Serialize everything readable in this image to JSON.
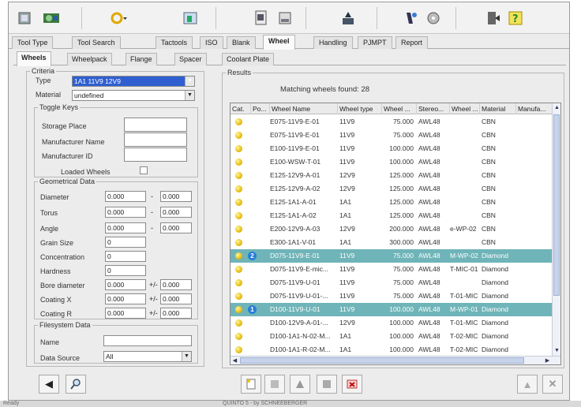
{
  "tabs_main": [
    {
      "label": "Tool Type"
    },
    {
      "label": "Tool Search"
    },
    {
      "label": "Tactools"
    },
    {
      "label": "ISO"
    },
    {
      "label": "Blank"
    },
    {
      "label": "Wheel"
    },
    {
      "label": "Handling"
    },
    {
      "label": "PJMPT"
    },
    {
      "label": "Report"
    }
  ],
  "tabs_sub": [
    {
      "label": "Wheels"
    },
    {
      "label": "Wheelpack"
    },
    {
      "label": "Flange"
    },
    {
      "label": "Spacer"
    },
    {
      "label": "Coolant Plate"
    }
  ],
  "criteria": {
    "legend": "Criteria",
    "type_label": "Type",
    "type_value": "1A1 11V9 12V9",
    "material_label": "Material",
    "material_value": "undefined"
  },
  "toggle_keys": {
    "legend": "Toggle Keys",
    "storage_place": "Storage Place",
    "manufacturer_name": "Manufacturer Name",
    "manufacturer_id": "Manufacturer ID",
    "loaded_wheels": "Loaded Wheels"
  },
  "geometrical": {
    "legend": "Geometrical Data",
    "diameter": "Diameter",
    "diameter_from": "0.000",
    "diameter_to": "0.000",
    "torus": "Torus",
    "torus_from": "0.000",
    "torus_to": "0.000",
    "angle": "Angle",
    "angle_from": "0.000",
    "angle_to": "0.000",
    "grain_size": "Grain Size",
    "grain_size_value": "0",
    "concentration": "Concentration",
    "concentration_value": "0",
    "hardness": "Hardness",
    "hardness_value": "0",
    "bore_diameter": "Bore diameter",
    "bore_diameter_value": "0.000",
    "bore_diameter_tol": "0.000",
    "coating_x": "Coating X",
    "coating_x_value": "0.000",
    "coating_x_tol": "0.000",
    "coating_r": "Coating R",
    "coating_r_value": "0.000",
    "coating_r_tol": "0.000",
    "plus_minus": "+/-",
    "range_dash": "-"
  },
  "filesystem": {
    "legend": "Filesystem Data",
    "name_label": "Name",
    "data_source_label": "Data Source",
    "data_source_value": "All"
  },
  "results": {
    "legend": "Results",
    "matching_text": "Matching wheels found: 28",
    "columns": [
      "Cat.",
      "Po...",
      "Wheel Name",
      "Wheel type",
      "Wheel ...",
      "Stereo...",
      "Wheel ...",
      "Material",
      "Manufa..."
    ],
    "rows": [
      {
        "pos": "",
        "name": "E075-11V9-E-01",
        "wtype": "11V9",
        "dia": "75.000",
        "stereo": "AWL48",
        "wheel": "",
        "material": "CBN",
        "hl": false
      },
      {
        "pos": "",
        "name": "E075-11V9-E-01",
        "wtype": "11V9",
        "dia": "75.000",
        "stereo": "AWL48",
        "wheel": "",
        "material": "CBN",
        "hl": false
      },
      {
        "pos": "",
        "name": "E100-11V9-E-01",
        "wtype": "11V9",
        "dia": "100.000",
        "stereo": "AWL48",
        "wheel": "",
        "material": "CBN",
        "hl": false
      },
      {
        "pos": "",
        "name": "E100-WSW-T-01",
        "wtype": "11V9",
        "dia": "100.000",
        "stereo": "AWL48",
        "wheel": "",
        "material": "CBN",
        "hl": false
      },
      {
        "pos": "",
        "name": "E125-12V9-A-01",
        "wtype": "12V9",
        "dia": "125.000",
        "stereo": "AWL48",
        "wheel": "",
        "material": "CBN",
        "hl": false
      },
      {
        "pos": "",
        "name": "E125-12V9-A-02",
        "wtype": "12V9",
        "dia": "125.000",
        "stereo": "AWL48",
        "wheel": "",
        "material": "CBN",
        "hl": false
      },
      {
        "pos": "",
        "name": "E125-1A1-A-01",
        "wtype": "1A1",
        "dia": "125.000",
        "stereo": "AWL48",
        "wheel": "",
        "material": "CBN",
        "hl": false
      },
      {
        "pos": "",
        "name": "E125-1A1-A-02",
        "wtype": "1A1",
        "dia": "125.000",
        "stereo": "AWL48",
        "wheel": "",
        "material": "CBN",
        "hl": false
      },
      {
        "pos": "",
        "name": "E200-12V9-A-03",
        "wtype": "12V9",
        "dia": "200.000",
        "stereo": "AWL48",
        "wheel": "e-WP-02",
        "material": "CBN",
        "hl": false
      },
      {
        "pos": "",
        "name": "E300-1A1-V-01",
        "wtype": "1A1",
        "dia": "300.000",
        "stereo": "AWL48",
        "wheel": "",
        "material": "CBN",
        "hl": false
      },
      {
        "pos": "2",
        "name": "D075-11V9-E-01",
        "wtype": "11V9",
        "dia": "75.000",
        "stereo": "AWL48",
        "wheel": "M-WP-02",
        "material": "Diamond",
        "hl": true
      },
      {
        "pos": "",
        "name": "D075-11V9-E-mic...",
        "wtype": "11V9",
        "dia": "75.000",
        "stereo": "AWL48",
        "wheel": "T-MIC-01",
        "material": "Diamond",
        "hl": false
      },
      {
        "pos": "",
        "name": "D075-11V9-U-01",
        "wtype": "11V9",
        "dia": "75.000",
        "stereo": "AWL48",
        "wheel": "",
        "material": "Diamond",
        "hl": false
      },
      {
        "pos": "",
        "name": "D075-11V9-U-01-...",
        "wtype": "11V9",
        "dia": "75.000",
        "stereo": "AWL48",
        "wheel": "T-01-MIC",
        "material": "Diamond",
        "hl": false
      },
      {
        "pos": "1",
        "name": "D100-11V9-U-01",
        "wtype": "11V9",
        "dia": "100.000",
        "stereo": "AWL48",
        "wheel": "M-WP-01",
        "material": "Diamond",
        "hl": true
      },
      {
        "pos": "",
        "name": "D100-12V9-A-01-...",
        "wtype": "12V9",
        "dia": "100.000",
        "stereo": "AWL48",
        "wheel": "T-01-MIC",
        "material": "Diamond",
        "hl": false
      },
      {
        "pos": "",
        "name": "D100-1A1-N-02-M...",
        "wtype": "1A1",
        "dia": "100.000",
        "stereo": "AWL48",
        "wheel": "T-02-MIC",
        "material": "Diamond",
        "hl": false
      },
      {
        "pos": "",
        "name": "D100-1A1-R-02-M...",
        "wtype": "1A1",
        "dia": "100.000",
        "stereo": "AWL48",
        "wheel": "T-02-MIC",
        "material": "Diamond",
        "hl": false
      }
    ]
  },
  "statusbar": {
    "left": "Ready",
    "center": "QUINTO 5 - by SCHNEEBERGER"
  },
  "colors": {
    "highlight": "#6fb4b8",
    "badge": "#2a7ed6"
  }
}
